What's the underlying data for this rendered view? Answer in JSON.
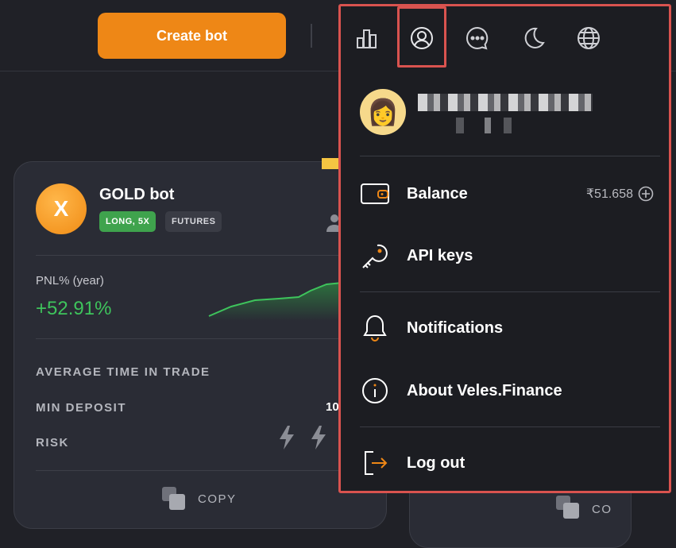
{
  "topbar": {
    "create_label": "Create bot"
  },
  "card": {
    "title": "GOLD bot",
    "avatar_letter": "X",
    "tags": [
      "LONG, 5X",
      "FUTURES"
    ],
    "pnl_label": "PNL% (year)",
    "pnl_value": "+52.91%",
    "stats": {
      "avg_time": "AVERAGE TIME IN TRADE",
      "min_deposit": "MIN DEPOSIT",
      "min_deposit_value": "10",
      "risk": "RISK"
    },
    "copy_label": "COPY"
  },
  "card2": {
    "copy_label_partial": "CO"
  },
  "dropdown": {
    "icons": [
      "chart-icon",
      "profile-icon",
      "chat-icon",
      "moon-icon",
      "globe-icon"
    ],
    "menu": {
      "balance": "Balance",
      "balance_value": "₹51.658",
      "api_keys": "API keys",
      "notifications": "Notifications",
      "about": "About Veles.Finance",
      "logout": "Log out"
    }
  },
  "colors": {
    "accent": "#ee8716",
    "positive": "#3ec45c",
    "highlight": "#d9534f"
  }
}
